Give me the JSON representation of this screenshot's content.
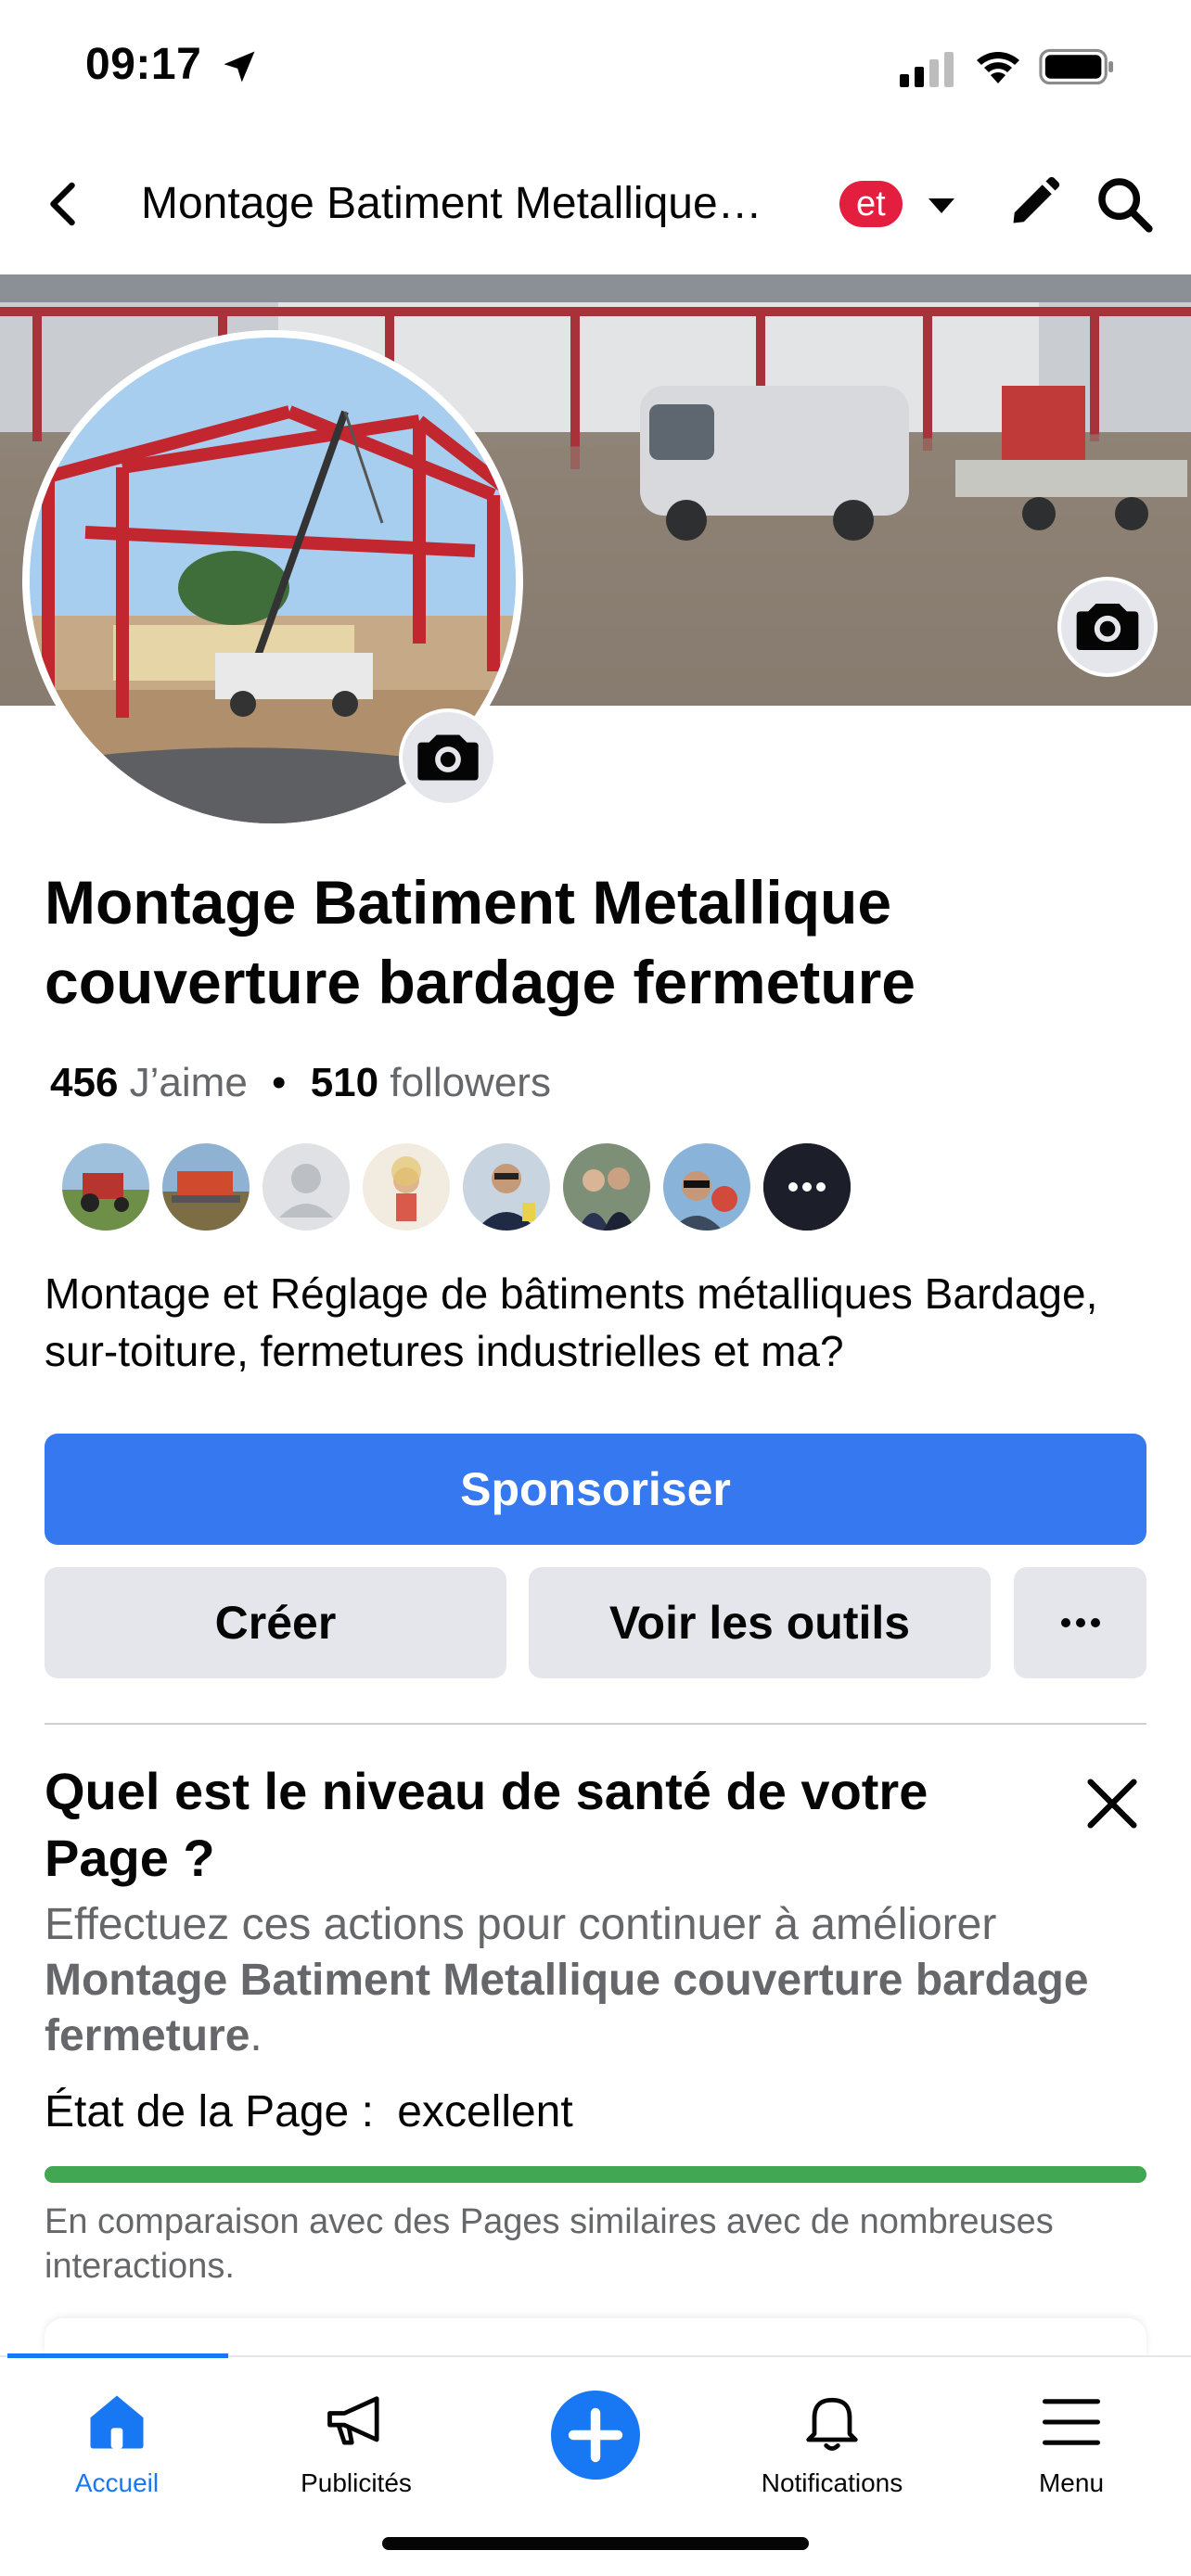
{
  "status_bar": {
    "time": "09:17"
  },
  "header": {
    "title": "Montage Batiment Metallique…",
    "badge": "et"
  },
  "page": {
    "name": "Montage Batiment Metallique couverture bardage fermeture",
    "likes_count": "456",
    "likes_label": "J’aime",
    "separator": "•",
    "followers_count": "510",
    "followers_label": "followers",
    "description": "Montage et Réglage de bâtiments métalliques Bardage, sur-toiture, fermetures industrielles et ma?"
  },
  "actions": {
    "sponsor": "Sponsoriser",
    "create": "Créer",
    "tools": "Voir les outils",
    "more": "•••"
  },
  "health": {
    "title": "Quel est le niveau de santé de votre Page ?",
    "subtitle_prefix": "Effectuez ces actions pour continuer à améliorer ",
    "subtitle_bold": "Montage Batiment Metallique couverture bardage fermeture",
    "subtitle_suffix": ".",
    "state_label": "État de la Page :",
    "state_value": "excellent",
    "progress_fraction": 1.0,
    "progress_color": "#42a752",
    "note": "En comparaison avec des Pages similaires avec de nombreuses interactions."
  },
  "bottom_nav": [
    {
      "label": "Accueil",
      "icon": "home-icon",
      "active": true
    },
    {
      "label": "Publicités",
      "icon": "megaphone-icon",
      "active": false
    },
    {
      "label": "",
      "icon": "plus-icon",
      "active": false
    },
    {
      "label": "Notifications",
      "icon": "bell-icon",
      "active": false
    },
    {
      "label": "Menu",
      "icon": "menu-icon",
      "active": false
    }
  ],
  "colors": {
    "accent": "#1877f2",
    "sponsor_button": "#3578f0",
    "badge": "#e41e3f",
    "muted_text": "#65676b",
    "secondary_button": "#e4e6eb"
  }
}
